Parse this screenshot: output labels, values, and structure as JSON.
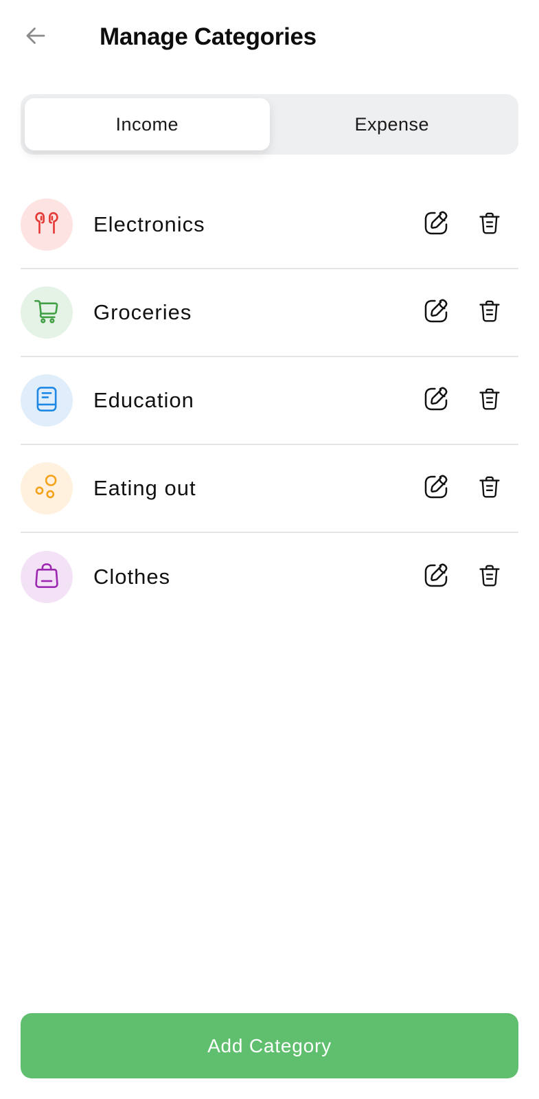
{
  "header": {
    "back_icon": "arrow-left-icon",
    "title": "Manage Categories"
  },
  "tabs": [
    {
      "label": "Income",
      "active": true
    },
    {
      "label": "Expense",
      "active": false
    }
  ],
  "categories": [
    {
      "label": "Electronics",
      "icon": "earphones-icon",
      "color": "#e53935",
      "bg": "#fde3e2"
    },
    {
      "label": "Groceries",
      "icon": "cart-icon",
      "color": "#43a047",
      "bg": "#e4f3e6"
    },
    {
      "label": "Education",
      "icon": "book-icon",
      "color": "#1e88e5",
      "bg": "#e0eefc"
    },
    {
      "label": "Eating out",
      "icon": "bubbles-icon",
      "color": "#f5a21b",
      "bg": "#fff1dd"
    },
    {
      "label": "Clothes",
      "icon": "bag-icon",
      "color": "#9c27b0",
      "bg": "#f3e2f5"
    }
  ],
  "row_actions": {
    "edit_icon": "edit-icon",
    "delete_icon": "trash-icon"
  },
  "footer": {
    "add_label": "Add Category",
    "accent": "#5fbf6e"
  }
}
